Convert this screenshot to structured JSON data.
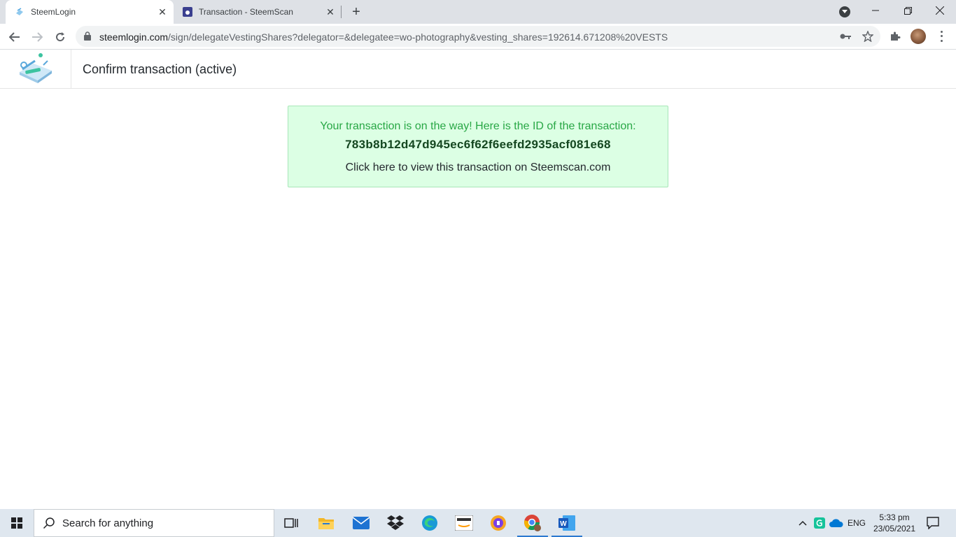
{
  "browser": {
    "tabs": [
      {
        "title": "SteemLogin",
        "active": true
      },
      {
        "title": "Transaction - SteemScan",
        "active": false
      }
    ],
    "url_host": "steemlogin.com",
    "url_path": "/sign/delegateVestingShares?delegator=&delegatee=wo-photography&vesting_shares=192614.671208%20VESTS"
  },
  "page": {
    "title": "Confirm transaction (active)",
    "success_message": "Your transaction is on the way! Here is the ID of the transaction:",
    "transaction_id": "783b8b12d47d945ec6f62f6eefd2935acf081e68",
    "view_link": "Click here to view this transaction on Steemscan.com"
  },
  "taskbar": {
    "search_placeholder": "Search for anything",
    "language": "ENG",
    "time": "5:33 pm",
    "date": "23/05/2021"
  },
  "colors": {
    "success_bg": "#dcffe4",
    "success_text": "#28a745",
    "tab_strip": "#dee1e6"
  }
}
